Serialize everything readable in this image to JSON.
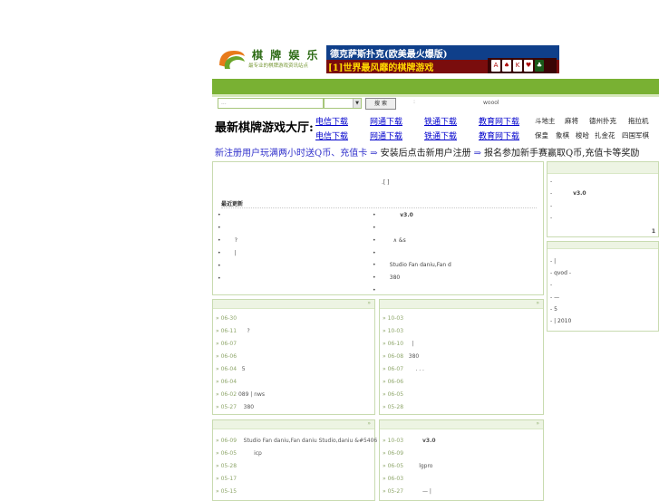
{
  "logo": {
    "title": "棋 牌 娱 乐",
    "subtitle": "最专业的棋牌游戏资讯站点"
  },
  "banner": {
    "line1": "德克萨斯扑克(欧美最火爆版)",
    "line2": "[1]世界最风靡的棋牌游戏"
  },
  "search": {
    "placeholder": "...",
    "select_value": "",
    "button": "搜 索",
    "dot": ":"
  },
  "woool": "woool",
  "hall": {
    "title": "最新棋牌游戏大厅:",
    "downloads_row1": [
      "电信下载",
      "网通下载",
      "铁通下载",
      "教育网下载"
    ],
    "downloads_row2": [
      "电信下载",
      "网通下载",
      "铁通下载",
      "教育网下载"
    ],
    "games_row1": [
      "斗地主",
      "麻将",
      "德州扑克",
      "拖拉机"
    ],
    "games_row2": [
      "保皇",
      "象棋",
      "梭哈",
      "扎金花",
      "四国军棋"
    ]
  },
  "promo": {
    "p1": "新注册用户玩满两小时送Q币、充值卡",
    "arrow": "⇒",
    "p2": "安装后点击新用户注册",
    "p3": "报名参加新手赛赢取Q币,充值卡等奖励"
  },
  "main_panel": {
    "top_text": ".[ ]",
    "section_title": "最近更新",
    "left_items": [
      "",
      "",
      "?",
      "|",
      "",
      ""
    ],
    "right_items": [
      "v3.0",
      "",
      "∧     &s",
      "",
      "Studio Fan daniu,Fan d",
      "380",
      ""
    ]
  },
  "side_panel1": {
    "items": [
      "-",
      "-       v3.0",
      "-",
      "-"
    ],
    "page": "1"
  },
  "side_panel2": {
    "items": [
      "-     |",
      "- qvod -",
      "-",
      "-               —",
      "-    5",
      "-     |      2010"
    ]
  },
  "list_left1": [
    {
      "d": "» 06-30",
      "t": ""
    },
    {
      "d": "» 06-11",
      "t": "?"
    },
    {
      "d": "» 06-07",
      "t": ""
    },
    {
      "d": "» 06-06",
      "t": ""
    },
    {
      "d": "» 06-04",
      "t": "5"
    },
    {
      "d": "» 06-04",
      "t": ""
    },
    {
      "d": "» 06-02",
      "t": "089     |        nws"
    },
    {
      "d": "» 05-27",
      "t": "380"
    }
  ],
  "list_right1": [
    {
      "d": "» 10-03",
      "t": ""
    },
    {
      "d": "» 10-03",
      "t": ""
    },
    {
      "d": "» 06-10",
      "t": "|"
    },
    {
      "d": "» 06-08",
      "t": "380"
    },
    {
      "d": "» 06-07",
      "t": ".      .      ."
    },
    {
      "d": "» 06-06",
      "t": ""
    },
    {
      "d": "» 06-05",
      "t": ""
    },
    {
      "d": "» 05-28",
      "t": ""
    }
  ],
  "list_left2": [
    {
      "d": "» 06-09",
      "t": "Studio Fan daniu,Fan daniu Studio,daniu &#5406"
    },
    {
      "d": "» 06-05",
      "t": "icp"
    },
    {
      "d": "» 05-28",
      "t": ""
    },
    {
      "d": "» 05-17",
      "t": ""
    },
    {
      "d": "» 05-15",
      "t": ""
    }
  ],
  "list_right2": [
    {
      "d": "» 10-03",
      "t": "v3.0"
    },
    {
      "d": "» 06-09",
      "t": ""
    },
    {
      "d": "» 06-05",
      "t": "lgpro"
    },
    {
      "d": "» 06-03",
      "t": ""
    },
    {
      "d": "» 05-27",
      "t": "—    |"
    }
  ]
}
